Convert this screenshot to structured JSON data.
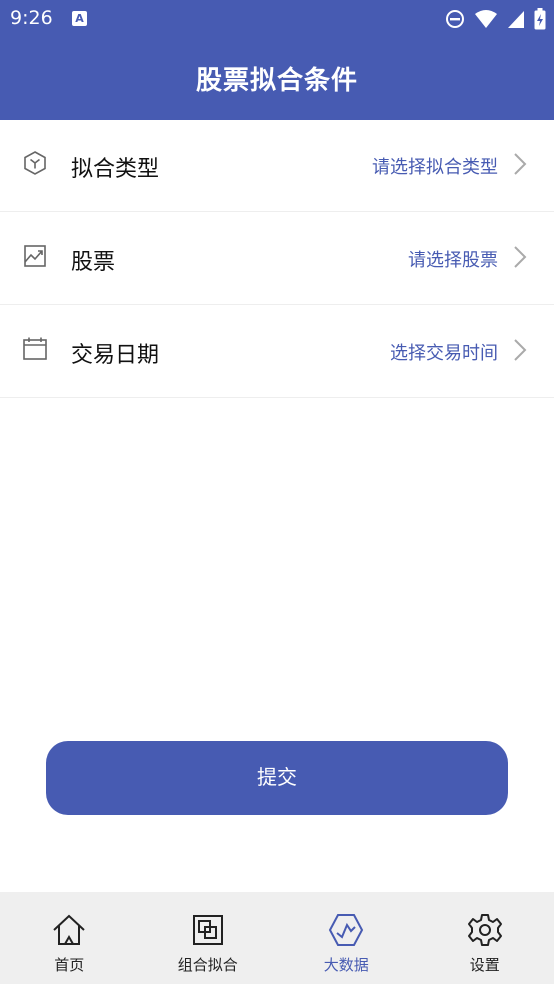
{
  "status_bar": {
    "time": "9:26",
    "a_badge": "A"
  },
  "header": {
    "title": "股票拟合条件"
  },
  "form": {
    "rows": [
      {
        "label": "拟合类型",
        "value": "请选择拟合类型",
        "icon": "cube-icon"
      },
      {
        "label": "股票",
        "value": "请选择股票",
        "icon": "stock-chart-icon"
      },
      {
        "label": "交易日期",
        "value": "选择交易时间",
        "icon": "calendar-icon"
      }
    ]
  },
  "submit": {
    "label": "提交"
  },
  "tabbar": {
    "active_color": "#475bb2",
    "items": [
      {
        "label": "首页",
        "icon": "home-icon"
      },
      {
        "label": "组合拟合",
        "icon": "combo-icon"
      },
      {
        "label": "大数据",
        "icon": "big-data-icon"
      },
      {
        "label": "设置",
        "icon": "gear-icon"
      }
    ],
    "active_index": 2
  },
  "colors": {
    "primary": "#475bb2",
    "background": "#ffffff",
    "tabbar_bg": "#efefef"
  }
}
